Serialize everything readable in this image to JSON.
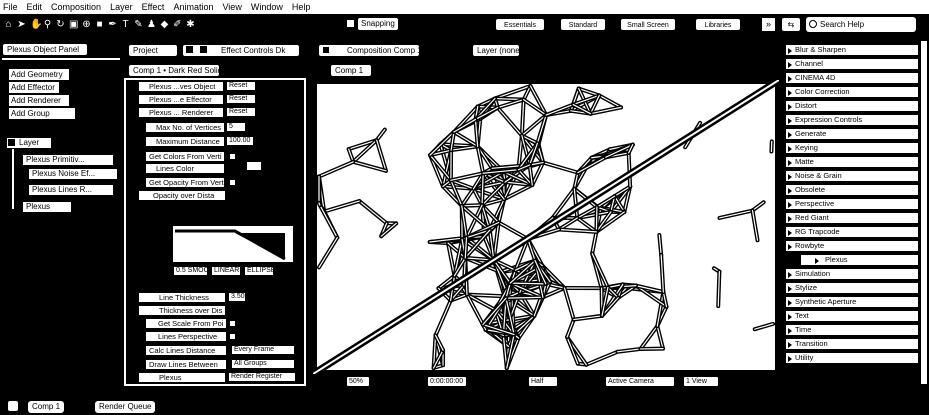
{
  "menu": [
    "File",
    "Edit",
    "Composition",
    "Layer",
    "Effect",
    "Animation",
    "View",
    "Window",
    "Help"
  ],
  "toolbar": {
    "snapping_label": "Snapping",
    "workspaces": [
      "Essentials",
      "Standard",
      "Small Screen",
      "Libraries"
    ],
    "search_placeholder": "Search Help"
  },
  "left_panel": {
    "title": "Plexus Object Panel",
    "add_buttons": [
      "Add Geometry",
      "Add Effector",
      "Add Renderer",
      "Add Group"
    ],
    "tree_root": "Layer",
    "tree_items": [
      "Plexus Primitiv...",
      "Plexus Noise Ef...",
      "Plexus Lines R...",
      "Plexus"
    ]
  },
  "effect_panel": {
    "tab_project": "Project",
    "tab_effect": "Effect Controls Dk",
    "breadcrumb": "Comp 1 • Dark Red Solid",
    "groups": [
      {
        "label": "Plexus ...ves Object",
        "value": "Reset"
      },
      {
        "label": "Plexus ...e Effector",
        "value": "Reset"
      },
      {
        "label": "Plexus ... Renderer",
        "value": "Reset"
      }
    ],
    "props": [
      {
        "label": "Max No. of Vertices",
        "value": "5"
      },
      {
        "label": "Maximum Distance",
        "value": "100.00"
      },
      {
        "label": "Get Colors From Verti",
        "value": ""
      },
      {
        "label": "Lines Color",
        "value": ""
      },
      {
        "label": "Get Opacity From Vert",
        "value": ""
      },
      {
        "label": "Opacity over Dista",
        "value": ""
      }
    ],
    "graph_labels": [
      "0.5 SMOOTH",
      "LINEAR",
      "ELLIPSE"
    ],
    "props2": [
      {
        "label": "Line Thickness",
        "value": "3.50"
      },
      {
        "label": "Thickness over Dis",
        "value": ""
      },
      {
        "label": "Get Scale From Poi",
        "value": ""
      },
      {
        "label": "Lines Perspective",
        "value": ""
      },
      {
        "label": "Calc Lines Distance",
        "value": "Every Frame"
      },
      {
        "label": "Draw Lines Between",
        "value": "All Groups"
      },
      {
        "label": "Plexus",
        "value": "Render Register"
      }
    ]
  },
  "composition": {
    "tab": "Composition Comp 1",
    "layer_tab": "Layer (none)",
    "comp_chip": "Comp 1",
    "zoom": "50%",
    "timecode": "0:00:00:00",
    "resolution": "Half",
    "camera": "Active Camera",
    "views": "1 View"
  },
  "effects_list": {
    "items": [
      "Blur & Sharpen",
      "Channel",
      "CINEMA 4D",
      "Color Correction",
      "Distort",
      "Expression Controls",
      "Generate",
      "Keying",
      "Matte",
      "Noise & Grain",
      "Obsolete",
      "Perspective",
      "Red Giant",
      "RG Trapcode",
      "Rowbyte",
      "Plexus",
      "Simulation",
      "Stylize",
      "Synthetic Aperture",
      "Text",
      "Time",
      "Transition",
      "Utility"
    ]
  },
  "bottom": {
    "comp_tab": "Comp 1",
    "render_tab": "Render Queue"
  }
}
